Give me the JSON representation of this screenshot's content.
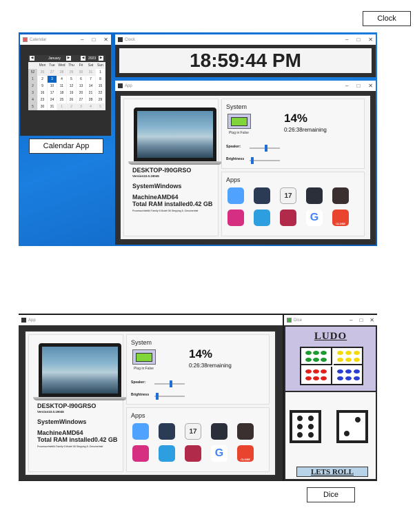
{
  "captions": {
    "clock": "Clock",
    "calendar": "Calendar App",
    "dice": "Dice"
  },
  "calendar": {
    "window_title": "Calendar",
    "month": "January",
    "year": "2023",
    "headers": [
      "",
      "Mon",
      "Tue",
      "Wed",
      "Thu",
      "Fri",
      "Sat",
      "Sun"
    ],
    "weeks": [
      [
        "52",
        "26",
        "27",
        "28",
        "29",
        "30",
        "31",
        "1"
      ],
      [
        "1",
        "2",
        "3",
        "4",
        "5",
        "6",
        "7",
        "8"
      ],
      [
        "2",
        "9",
        "10",
        "11",
        "12",
        "13",
        "14",
        "15"
      ],
      [
        "3",
        "16",
        "17",
        "18",
        "19",
        "20",
        "21",
        "22"
      ],
      [
        "4",
        "23",
        "24",
        "25",
        "26",
        "27",
        "28",
        "29"
      ],
      [
        "5",
        "30",
        "31",
        "1",
        "2",
        "3",
        "4",
        "5"
      ]
    ],
    "selected": "3"
  },
  "clock": {
    "window_title": "Clock",
    "time": "18:59:44 PM"
  },
  "app": {
    "window_title": "App",
    "hostname": "DESKTOP-I90GRSO",
    "version": "Version10.0.19045",
    "system": "SystemWindows",
    "machine": "MachineAMD64",
    "ram": "Total RAM installed0.42 GB",
    "processor": "ProcessorIntel64 Family 6 Model 55 Stepping 8, GenuineIntel",
    "system_label": "System",
    "battery_percent": "14%",
    "battery_level": 0.14,
    "remaining": "0:26:38remaining",
    "plug": "Plug in:False",
    "speaker_label": "Speaker:",
    "speaker_level": 0.55,
    "brightness_label": "Brightness",
    "brightness_level": 0.05,
    "apps_label": "Apps",
    "apps": [
      {
        "name": "weather-app-icon",
        "color": "#4fa3ff"
      },
      {
        "name": "clock-app-icon",
        "color": "#2b3a55"
      },
      {
        "name": "calendar-app-icon",
        "color": "#f2f2f2",
        "text": "17"
      },
      {
        "name": "toggle-app-icon",
        "color": "#2a2f3a"
      },
      {
        "name": "ludo-app-icon",
        "color": "#3a3030"
      },
      {
        "name": "instagram-app-icon",
        "color": "#d62f82"
      },
      {
        "name": "folder-app-icon",
        "color": "#2d9ee0"
      },
      {
        "name": "youtube-app-icon",
        "color": "#b22a4a"
      },
      {
        "name": "google-app-icon",
        "color": "#ffffff",
        "text": "G"
      },
      {
        "name": "close-app-icon",
        "color": "#e8442e",
        "text": "CLOSE"
      }
    ]
  },
  "dice": {
    "window_title": "Dice",
    "ludo_title": "LUDO",
    "roll_button": "LETS ROLL",
    "die1": 6,
    "die2": 2
  }
}
